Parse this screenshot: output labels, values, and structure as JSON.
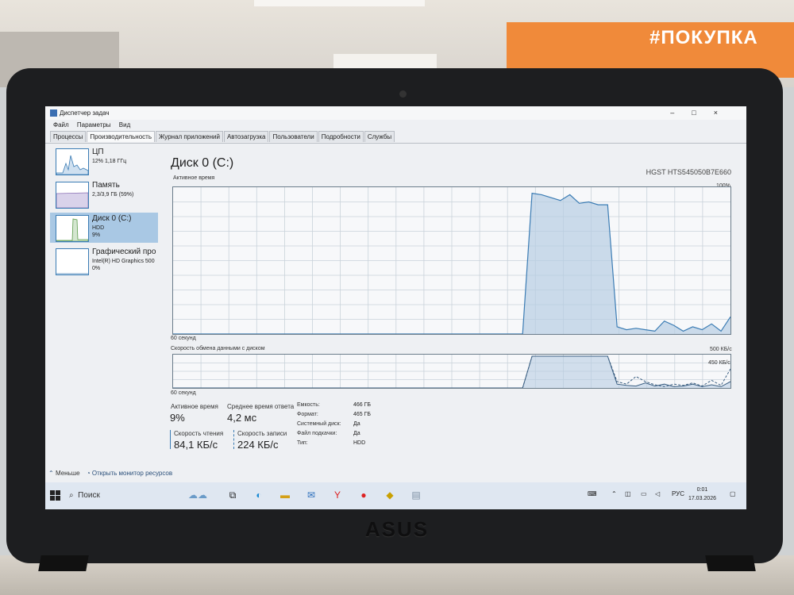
{
  "environment": {
    "store_sign": "#ПОКУПКА",
    "laptop_brand": "ASUS"
  },
  "window": {
    "title": "Диспетчер задач",
    "controls": [
      "–",
      "□",
      "×"
    ],
    "menu": [
      "Файл",
      "Параметры",
      "Вид"
    ],
    "tabs": [
      "Процессы",
      "Производительность",
      "Журнал приложений",
      "Автозагрузка",
      "Пользователи",
      "Подробности",
      "Службы"
    ],
    "active_tab": "Производительность"
  },
  "sidebar": {
    "items": [
      {
        "name": "ЦП",
        "line1": "12%  1,18 ГГц",
        "line2": ""
      },
      {
        "name": "Память",
        "line1": "2,3/3,9 ГБ (59%)",
        "line2": ""
      },
      {
        "name": "Диск 0 (C:)",
        "line1": "HDD",
        "line2": "9%"
      },
      {
        "name": "Графический про",
        "line1": "Intel(R) HD Graphics 500",
        "line2": "0%"
      }
    ]
  },
  "main": {
    "title": "Диск 0 (C:)",
    "model": "HGST HTS545050B7E660",
    "active_time_label": "Активное время",
    "active_max": "100%",
    "duration_label": "60 секунд",
    "transfer_label": "Скорость обмена данными с диском",
    "transfer_max": "500 КБ/с",
    "transfer_secondary": "450 КБ/с",
    "stats": {
      "active_time": {
        "label": "Активное время",
        "value": "9%"
      },
      "avg_response": {
        "label": "Среднее время ответа",
        "value": "4,2 мс"
      },
      "read_speed": {
        "label": "Скорость чтения",
        "value": "84,1 КБ/с"
      },
      "write_speed": {
        "label": "Скорость записи",
        "value": "224 КБ/с"
      }
    },
    "info": [
      {
        "key": "Емкость:",
        "value": "466 ГБ"
      },
      {
        "key": "Формат:",
        "value": "465 ГБ"
      },
      {
        "key": "Системный диск:",
        "value": "Да"
      },
      {
        "key": "Файл подкачки:",
        "value": "Да"
      },
      {
        "key": "Тип:",
        "value": "HDD"
      }
    ],
    "less_label": "Меньше",
    "monitor_link": "Открыть монитор ресурсов"
  },
  "chart_data": {
    "type": "area",
    "title": "Активное время",
    "x_range_label": "60 секунд",
    "ylim": [
      0,
      100
    ],
    "series": [
      {
        "name": "Активное время",
        "color": "#3b7cb4",
        "values": [
          0,
          0,
          0,
          0,
          0,
          0,
          0,
          0,
          0,
          0,
          0,
          0,
          0,
          0,
          0,
          0,
          0,
          0,
          0,
          0,
          0,
          0,
          0,
          0,
          0,
          0,
          0,
          0,
          0,
          0,
          0,
          0,
          0,
          0,
          0,
          0,
          0,
          0,
          98,
          97,
          95,
          93,
          97,
          91,
          92,
          90,
          90,
          5,
          3,
          4,
          3,
          2,
          9,
          6,
          2,
          5,
          3,
          7,
          2,
          12
        ]
      }
    ],
    "secondary": {
      "type": "line",
      "title": "Скорость обмена данными с диском",
      "ylim": [
        0,
        500
      ],
      "series": [
        {
          "name": "Скорость чтения",
          "values": [
            0,
            0,
            0,
            0,
            0,
            0,
            0,
            0,
            0,
            0,
            0,
            0,
            0,
            0,
            0,
            0,
            0,
            0,
            0,
            0,
            0,
            0,
            0,
            0,
            0,
            0,
            0,
            0,
            0,
            0,
            0,
            0,
            0,
            0,
            0,
            0,
            0,
            0,
            500,
            500,
            500,
            500,
            500,
            500,
            500,
            500,
            500,
            60,
            40,
            30,
            80,
            30,
            60,
            20,
            30,
            60,
            20,
            50,
            20,
            100
          ]
        },
        {
          "name": "Скорость записи",
          "values": [
            0,
            0,
            0,
            0,
            0,
            0,
            0,
            0,
            0,
            0,
            0,
            0,
            0,
            0,
            0,
            0,
            0,
            0,
            0,
            0,
            0,
            0,
            0,
            0,
            0,
            0,
            0,
            0,
            0,
            0,
            0,
            0,
            0,
            0,
            0,
            0,
            0,
            0,
            500,
            500,
            500,
            500,
            500,
            500,
            500,
            500,
            500,
            100,
            60,
            180,
            100,
            50,
            20,
            60,
            40,
            80,
            30,
            120,
            40,
            300
          ]
        }
      ]
    }
  },
  "taskbar": {
    "search_label": "Поиск",
    "language": "РУС",
    "time": "0:01",
    "date": "17.03.2026"
  },
  "colors": {
    "accent": "#3b7cb4",
    "selected": "#a9c8e4",
    "screen_bg": "#eef0f3"
  }
}
